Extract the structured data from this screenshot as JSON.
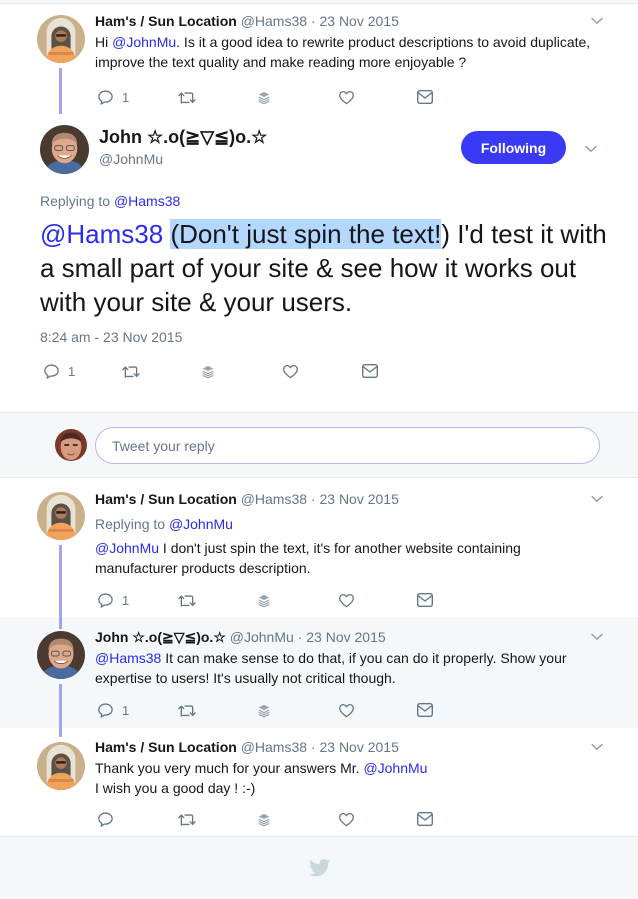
{
  "colors": {
    "accent": "#3a3af5",
    "mention": "#2b2bf0",
    "muted": "#657786",
    "thread_line": "#a3a3ee",
    "highlight": "#b3d7fe",
    "alt_background": "#f5f8fa"
  },
  "thread": {
    "parent_tweet": {
      "author_name": "Ham's / Sun Location",
      "handle": "@Hams38",
      "separator": " · ",
      "date": "23 Nov 2015",
      "text_prefix": "Hi ",
      "mention": "@JohnMu",
      "text_rest": ". Is it a good idea to rewrite product descriptions to avoid duplicate, improve the text quality and make reading more enjoyable ?",
      "reply_count": "1",
      "icons": [
        "reply-icon",
        "retweet-icon",
        "buffer-icon",
        "like-icon",
        "dm-icon"
      ]
    },
    "main_tweet": {
      "author_name": "John ☆.o(≧▽≦)o.☆",
      "handle": "@JohnMu",
      "follow_button": "Following",
      "replying_to_label": "Replying to ",
      "replying_to_handle": "@Hams38",
      "mention": "@Hams38",
      "highlighted_text": "(Don't just spin the text!",
      "text_rest": ") I'd test it with a small part of your site & see how it works out with your site & your users.",
      "timestamp": "8:24 am - 23 Nov 2015",
      "reply_count": "1",
      "icons": [
        "reply-icon",
        "retweet-icon",
        "buffer-icon",
        "like-icon",
        "dm-icon"
      ]
    },
    "reply_composer": {
      "placeholder": "Tweet your reply",
      "value": ""
    },
    "replies": [
      {
        "author_name": "Ham's / Sun Location",
        "handle": "@Hams38",
        "separator": " · ",
        "date": "23 Nov 2015",
        "replying_to_label": "Replying to ",
        "replying_to_handle": "@JohnMu",
        "mention": "@JohnMu",
        "text_rest": " I don't just spin the text, it's for another website containing manufacturer products description.",
        "reply_count": "1"
      },
      {
        "author_name": "John ☆.o(≧▽≦)o.☆",
        "handle": "@JohnMu",
        "separator": " · ",
        "date": "23 Nov 2015",
        "mention": "@Hams38",
        "text_rest": " It can make sense to do that, if you can do it properly. Show your expertise to users! It's usually not critical though.",
        "reply_count": "1"
      },
      {
        "author_name": "Ham's / Sun Location",
        "handle": "@Hams38",
        "separator": " · ",
        "date": "23 Nov 2015",
        "text_line1_prefix": "Thank you very much for your answers Mr. ",
        "mention": "@JohnMu",
        "text_line2": "I wish you a good day ! :-)",
        "reply_count": ""
      }
    ]
  },
  "footer": {
    "icon": "twitter-bird-icon"
  }
}
